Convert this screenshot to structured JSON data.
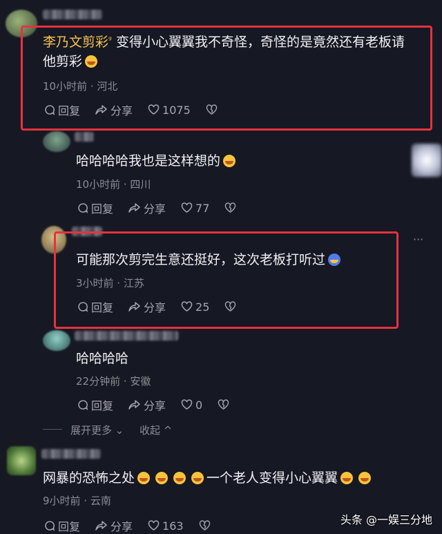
{
  "comments": [
    {
      "author": "李乃文剪彩",
      "text": "变得小心翼翼我不奇怪，奇怪的是竟然还有老板请",
      "text_line2": "他剪彩",
      "meta": "10小时前 · 河北",
      "reply_label": "回复",
      "share_label": "分享",
      "likes": "1075"
    },
    {
      "text": "哈哈哈哈我也是这样想的",
      "meta": "10小时前 · 四川",
      "reply_label": "回复",
      "share_label": "分享",
      "likes": "77"
    },
    {
      "text": "可能那次剪完生意还挺好，这次老板打听过",
      "meta": "3小时前 · 江苏",
      "reply_label": "回复",
      "share_label": "分享",
      "likes": "25"
    },
    {
      "text": "哈哈哈哈",
      "meta": "22分钟前 · 安徽",
      "reply_label": "回复",
      "share_label": "分享",
      "likes": "0"
    },
    {
      "text_a": "网暴的恐怖之处",
      "text_b": "一个老人变得小心翼翼",
      "meta": "9小时前 · 云南",
      "reply_label": "回复",
      "share_label": "分享",
      "likes": "163"
    }
  ],
  "thread": {
    "expand_label": "展开更多",
    "collapse_label": "收起"
  },
  "more_menu": "···",
  "watermark": "头条 @一娱三分地",
  "colors": {
    "background": "#161823",
    "highlight_box": "#e8323d",
    "author_name": "#f5c350"
  }
}
